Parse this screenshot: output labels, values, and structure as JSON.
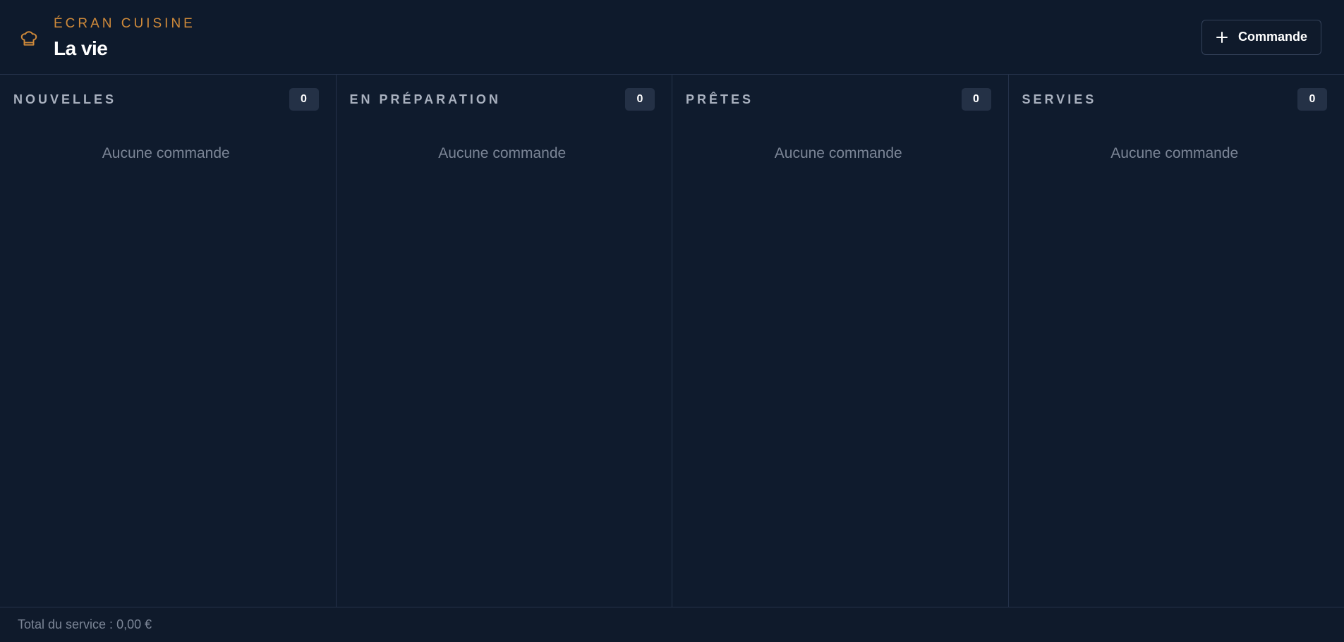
{
  "header": {
    "eyebrow": "ÉCRAN CUISINE",
    "title": "La vie",
    "icon": "chef-hat-icon",
    "new_order_label": "Commande"
  },
  "columns": [
    {
      "title": "NOUVELLES",
      "count": "0",
      "empty": "Aucune commande"
    },
    {
      "title": "EN PRÉPARATION",
      "count": "0",
      "empty": "Aucune commande"
    },
    {
      "title": "PRÊTES",
      "count": "0",
      "empty": "Aucune commande"
    },
    {
      "title": "SERVIES",
      "count": "0",
      "empty": "Aucune commande"
    }
  ],
  "footer": {
    "total": "Total du service : 0,00 €"
  },
  "colors": {
    "background": "#0f1a2b",
    "accent": "#d08a3a",
    "border": "#25324a",
    "badge": "#243146"
  }
}
